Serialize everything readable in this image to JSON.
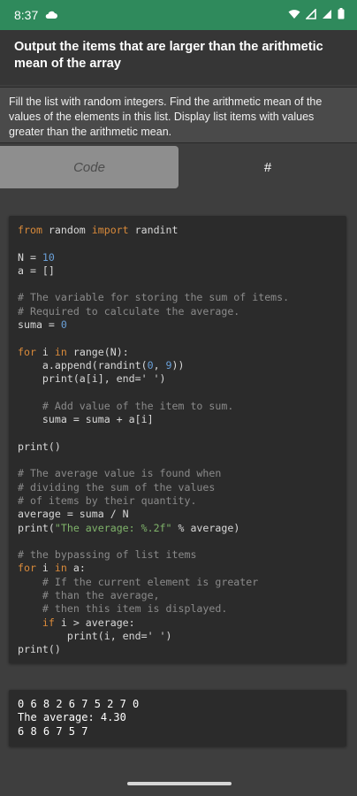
{
  "status": {
    "time": "8:37",
    "icons": [
      "cloud-icon",
      "wifi-icon",
      "signal-icon",
      "battery-icon"
    ]
  },
  "header": {
    "title": "Output the items that are larger than the arithmetic mean of the array"
  },
  "task": {
    "description": "Fill the list with random integers. Find the arithmetic mean of the values of the elements in this list. Display list items with values greater than the arithmetic mean."
  },
  "tabs": [
    {
      "label": "Code",
      "selected": true
    },
    {
      "label": "#",
      "selected": false
    }
  ],
  "code": {
    "lines": [
      "from random import randint",
      "",
      "N = 10",
      "a = []",
      "",
      "# The variable for storing the sum of items.",
      "# Required to calculate the average.",
      "suma = 0",
      "",
      "for i in range(N):",
      "    a.append(randint(0, 9))",
      "    print(a[i], end=' ')",
      "",
      "    # Add value of the item to sum.",
      "    suma = suma + a[i]",
      "",
      "print()",
      "",
      "# The average value is found when",
      "# dividing the sum of the values",
      "# of items by their quantity.",
      "average = suma / N",
      "print(\"The average: %.2f\" % average)",
      "",
      "# the bypassing of list items",
      "for i in a:",
      "    # If the current element is greater",
      "    # than the average,",
      "    # then this item is displayed.",
      "    if i > average:",
      "        print(i, end=' ')",
      "print()"
    ]
  },
  "output": {
    "lines": [
      "0 6 8 2 6 7 5 2 7 0",
      "The average: 4.30",
      "6 8 6 7 5 7"
    ]
  },
  "colors": {
    "status_bar": "#2f8a5c",
    "keyword": "#d98a3a",
    "number": "#6aa0d8",
    "comment": "#8a8a8a",
    "string": "#7fb36a"
  }
}
